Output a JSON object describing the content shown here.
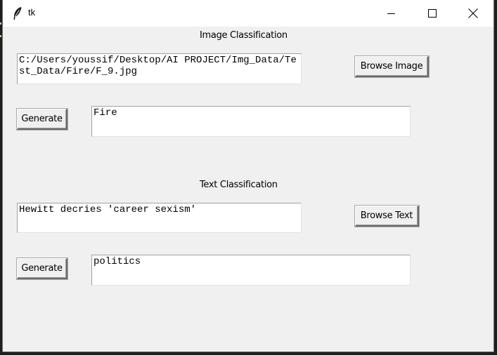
{
  "window": {
    "title": "tk",
    "controls": [
      "minimize",
      "maximize",
      "close"
    ]
  },
  "image_section": {
    "label": "Image Classification",
    "path_value": "C:/Users/youssif/Desktop/AI PROJECT/Img_Data/Test_Data/Fire/F_9.jpg",
    "browse_label": "Browse Image",
    "generate_label": "Generate",
    "result_value": "Fire"
  },
  "text_section": {
    "label": "Text Classification",
    "input_value": "Hewitt decries 'career sexism'",
    "browse_label": "Browse Text",
    "generate_label": "Generate",
    "result_value": "politics"
  }
}
